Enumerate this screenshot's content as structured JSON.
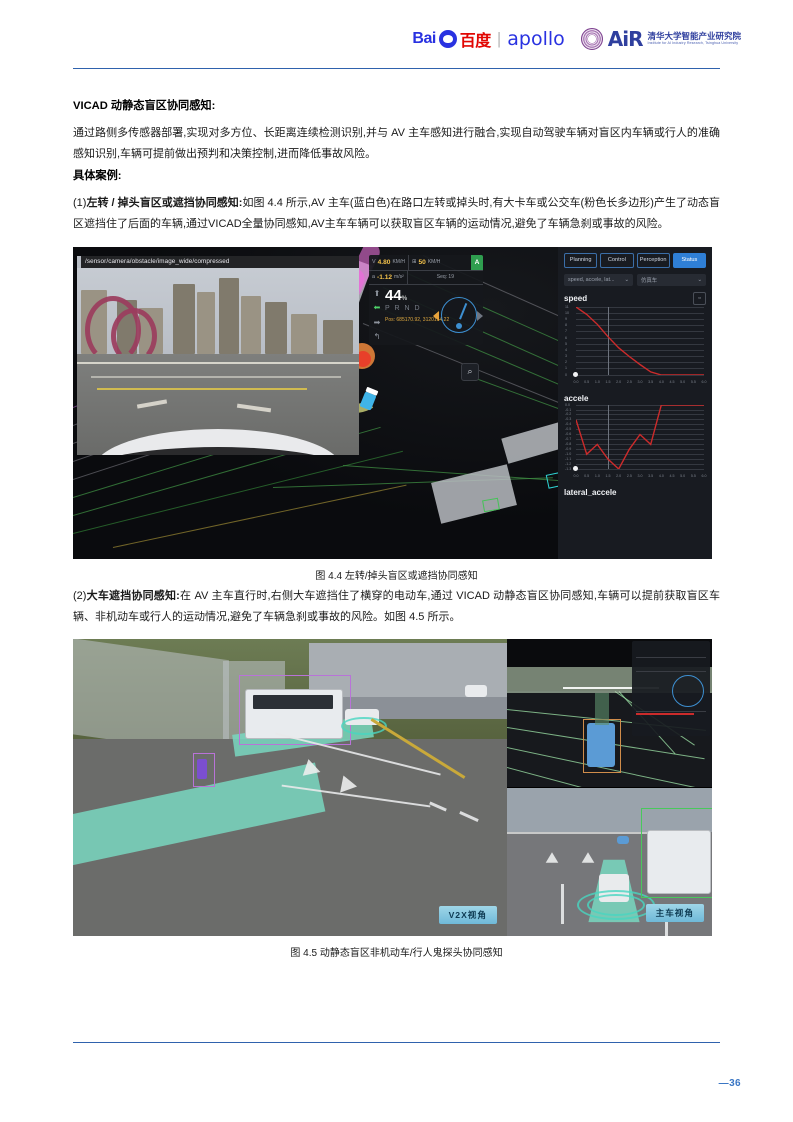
{
  "header": {
    "baidu_logo": {
      "bai": "Bai",
      "paw_icon": "baidu-paw-icon",
      "cn": "百度",
      "separator": "|"
    },
    "apollo_logo": "apollo",
    "air_logo": {
      "seal_icon": "tsinghua-seal-icon",
      "word": "AiR",
      "cn_top": "清华大学智能产业研究院",
      "cn_bottom": "Institute for AI Industry Research, Tsinghua University"
    }
  },
  "content": {
    "section_title": "VICAD 动静态盲区协同感知:",
    "intro": "通过路侧多传感器部署,实现对多方位、长距离连续检测识别,并与 AV 主车感知进行融合,实现自动驾驶车辆对盲区内车辆或行人的准确感知识别,车辆可提前做出预判和决策控制,进而降低事故风险。",
    "cases_title": "具体案例:",
    "case1": {
      "number": "(1)",
      "label": "左转 / 掉头盲区或遮挡协同感知:",
      "body": "如图 4.4 所示,AV 主车(蓝白色)在路口左转或掉头时,有大卡车或公交车(粉色长多边形)产生了动态盲区遮挡住了后面的车辆,通过VICAD全量协同感知,AV主车车辆可以获取盲区车辆的运动情况,避免了车辆急刹或事故的风险。"
    },
    "case2": {
      "number": "(2)",
      "label": "大车遮挡协同感知:",
      "body": "在 AV 主车直行时,右侧大车遮挡住了横穿的电动车,通过 VICAD 动静态盲区协同感知,车辆可以提前获取盲区车辆、非机动车或行人的运动情况,避免了车辆急刹或事故的风险。如图 4.5 所示。"
    }
  },
  "figure_44": {
    "caption": "图 4.4 左转/掉头盲区或遮挡协同感知",
    "camera_topic": "/sensor/camera/obstacle/image_wide/compressed",
    "hud": {
      "speed_key": "V",
      "speed_value": "4.80",
      "speed_unit": "KM/H",
      "limit_icon": "speed-limit-icon",
      "limit_value": "50",
      "limit_unit": "KM/H",
      "auto_badge": "A",
      "accel_key": "a",
      "accel_value": "-1.12",
      "accel_unit": "m/s²",
      "seq": "Seq: 19",
      "throttle": "44",
      "throttle_unit": "%",
      "gears": "P R N D",
      "gear_active": "D",
      "position": "Pos: 685170.92, 3120154.22"
    },
    "zoom_icon": "magnifier-icon",
    "dreamview": {
      "tabs": [
        "Planning",
        "Control",
        "Perception",
        "Status"
      ],
      "active_tab": "Status",
      "select_metrics": "speed, accele, lat...",
      "select_vehicle": "仿真车",
      "expand_icon": "expand-icon",
      "bottom_label": "lateral_accele"
    }
  },
  "chart_data": [
    {
      "type": "line",
      "title": "speed",
      "xlabel": "",
      "ylabel": "",
      "x": [
        0.0,
        0.5,
        1.0,
        1.5,
        2.0,
        2.5,
        3.0,
        3.5,
        4.0,
        4.5,
        5.0,
        5.5,
        6.0
      ],
      "series": [
        {
          "name": "speed",
          "color": "#cc2b2b",
          "values": [
            11.0,
            9.8,
            8.2,
            6.2,
            4.4,
            3.0,
            1.7,
            0.5,
            0.0,
            0.0,
            0.0,
            0.0,
            0.0
          ]
        }
      ],
      "xticks": [
        "0.0",
        "0.5",
        "1.0",
        "1.5",
        "2.0",
        "2.5",
        "3.0",
        "3.5",
        "4.0",
        "4.5",
        "5.0",
        "5.5",
        "6.0"
      ],
      "yticks": [
        "0",
        "1",
        "2",
        "3",
        "4",
        "5",
        "6",
        "7",
        "8",
        "9",
        "10",
        "11"
      ],
      "ylim": [
        0,
        11
      ],
      "xlim": [
        0.0,
        6.0
      ],
      "grid": true,
      "legend": "none"
    },
    {
      "type": "line",
      "title": "accele",
      "xlabel": "",
      "ylabel": "",
      "x": [
        0.0,
        0.5,
        1.0,
        1.5,
        2.0,
        2.5,
        3.0,
        3.5,
        4.0,
        4.5,
        5.0,
        5.5,
        6.0
      ],
      "series": [
        {
          "name": "accele",
          "color": "#cc2b2b",
          "values": [
            -0.3,
            -1.0,
            -0.8,
            -1.1,
            -1.3,
            -0.9,
            -0.6,
            -0.8,
            0.0,
            0.0,
            0.0,
            0.0,
            0.0
          ]
        }
      ],
      "xticks": [
        "0.0",
        "0.5",
        "1.0",
        "1.5",
        "2.0",
        "2.5",
        "3.0",
        "3.5",
        "4.0",
        "4.5",
        "5.0",
        "5.5",
        "6.0"
      ],
      "yticks": [
        "0.0",
        "-0.1",
        "-0.2",
        "-0.3",
        "-0.4",
        "-0.5",
        "-0.6",
        "-0.7",
        "-0.8",
        "-0.9",
        "-1.0",
        "-1.1",
        "-1.2",
        "-1.3"
      ],
      "ylim": [
        -1.3,
        0.0
      ],
      "xlim": [
        0.0,
        6.0
      ],
      "grid": true,
      "legend": "none"
    }
  ],
  "figure_45": {
    "caption": "图 4.5 动静态盲区非机动车/行人鬼探头协同感知",
    "v2x_tag": "V2X视角",
    "ego_tag": "主车视角"
  },
  "footer": {
    "page_number": "—36"
  },
  "colors": {
    "brand_blue": "#2f62ad",
    "baidu_blue": "#2932e1",
    "baidu_red": "#e10602",
    "accent_tab": "#2f7fd6",
    "chart_red": "#cc2b2b",
    "page_num": "#3a76c4"
  }
}
